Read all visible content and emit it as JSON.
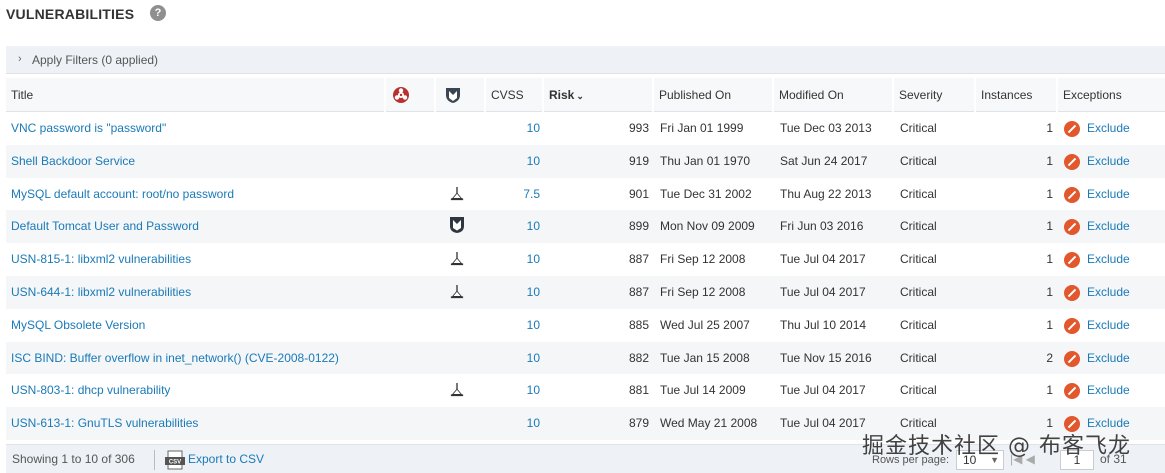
{
  "page": {
    "title": "VULNERABILITIES",
    "help_icon": "help-circle-icon"
  },
  "filters": {
    "label": "Apply Filters (0 applied)"
  },
  "table": {
    "headers": {
      "title": "Title",
      "malware_icon": "biohazard-icon",
      "exploit_icon": "metasploit-shield-icon",
      "cvss": "CVSS",
      "risk": "Risk",
      "published": "Published On",
      "modified": "Modified On",
      "severity": "Severity",
      "instances": "Instances",
      "exceptions": "Exceptions"
    },
    "sorted_by": "risk",
    "rows": [
      {
        "title": "VNC password is \"password\"",
        "exploit": "",
        "cvss": "10",
        "risk": "993",
        "published": "Fri Jan 01 1999",
        "modified": "Tue Dec 03 2013",
        "severity": "Critical",
        "instances": "1",
        "exception": "Exclude"
      },
      {
        "title": "Shell Backdoor Service",
        "exploit": "",
        "cvss": "10",
        "risk": "919",
        "published": "Thu Jan 01 1970",
        "modified": "Sat Jun 24 2017",
        "severity": "Critical",
        "instances": "1",
        "exception": "Exclude"
      },
      {
        "title": "MySQL default account: root/no password",
        "exploit": "exploit-db-icon",
        "cvss": "7.5",
        "risk": "901",
        "published": "Tue Dec 31 2002",
        "modified": "Thu Aug 22 2013",
        "severity": "Critical",
        "instances": "1",
        "exception": "Exclude"
      },
      {
        "title": "Default Tomcat User and Password",
        "exploit": "metasploit-icon",
        "cvss": "10",
        "risk": "899",
        "published": "Mon Nov 09 2009",
        "modified": "Fri Jun 03 2016",
        "severity": "Critical",
        "instances": "1",
        "exception": "Exclude"
      },
      {
        "title": "USN-815-1: libxml2 vulnerabilities",
        "exploit": "exploit-db-icon",
        "cvss": "10",
        "risk": "887",
        "published": "Fri Sep 12 2008",
        "modified": "Tue Jul 04 2017",
        "severity": "Critical",
        "instances": "1",
        "exception": "Exclude"
      },
      {
        "title": "USN-644-1: libxml2 vulnerabilities",
        "exploit": "exploit-db-icon",
        "cvss": "10",
        "risk": "887",
        "published": "Fri Sep 12 2008",
        "modified": "Tue Jul 04 2017",
        "severity": "Critical",
        "instances": "1",
        "exception": "Exclude"
      },
      {
        "title": "MySQL Obsolete Version",
        "exploit": "",
        "cvss": "10",
        "risk": "885",
        "published": "Wed Jul 25 2007",
        "modified": "Thu Jul 10 2014",
        "severity": "Critical",
        "instances": "1",
        "exception": "Exclude"
      },
      {
        "title": "ISC BIND: Buffer overflow in inet_network() (CVE-2008-0122)",
        "exploit": "",
        "cvss": "10",
        "risk": "882",
        "published": "Tue Jan 15 2008",
        "modified": "Tue Nov 15 2016",
        "severity": "Critical",
        "instances": "2",
        "exception": "Exclude"
      },
      {
        "title": "USN-803-1: dhcp vulnerability",
        "exploit": "exploit-db-icon",
        "cvss": "10",
        "risk": "881",
        "published": "Tue Jul 14 2009",
        "modified": "Tue Jul 04 2017",
        "severity": "Critical",
        "instances": "1",
        "exception": "Exclude"
      },
      {
        "title": "USN-613-1: GnuTLS vulnerabilities",
        "exploit": "",
        "cvss": "10",
        "risk": "879",
        "published": "Wed May 21 2008",
        "modified": "Tue Jul 04 2017",
        "severity": "Critical",
        "instances": "1",
        "exception": "Exclude"
      }
    ]
  },
  "footer": {
    "showing": "Showing 1 to 10 of 306",
    "export": "Export to CSV",
    "rows_per_page_label": "Rows per page:",
    "rows_per_page_value": "10",
    "pager_first_prev": "|◀ ◀",
    "page_value": "1",
    "of_pages": "of 31"
  },
  "watermark": "掘金技术社区 @ 布客飞龙",
  "colors": {
    "link": "#1a7ab8",
    "exclude": "#e2572c",
    "header_bg": "#f7f8fa",
    "stripe": "#f4f6f8"
  }
}
